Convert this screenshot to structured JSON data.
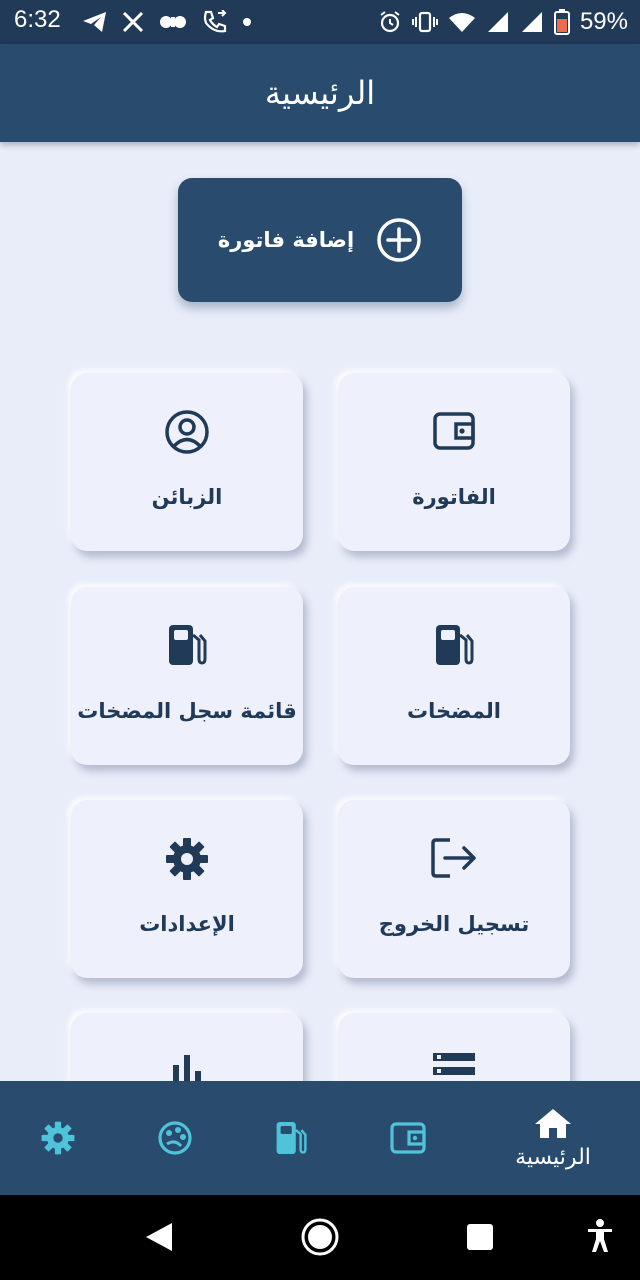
{
  "status_bar": {
    "time": "6:32",
    "battery_percent": "59%",
    "left_icons": [
      "telegram-icon",
      "x-icon",
      "voicemail-icon",
      "wifi-calling-icon",
      "dot-icon"
    ],
    "right_icons": [
      "alarm-icon",
      "vibrate-icon",
      "wifi-icon",
      "signal-icon",
      "signal-icon",
      "battery-icon"
    ]
  },
  "app_bar": {
    "title": "الرئيسية"
  },
  "add_invoice": {
    "label": "إضافة فاتورة",
    "icon": "plus-circle-icon"
  },
  "cards": [
    {
      "label": "الفاتورة",
      "icon": "wallet-icon"
    },
    {
      "label": "الزبائن",
      "icon": "user-circle-icon"
    },
    {
      "label": "المضخات",
      "icon": "fuel-pump-icon"
    },
    {
      "label": "قائمة سجل المضخات",
      "icon": "fuel-pump-icon"
    },
    {
      "label": "تسجيل الخروج",
      "icon": "logout-icon"
    },
    {
      "label": "الإعدادات",
      "icon": "gear-icon"
    },
    {
      "label": "",
      "icon": "list-icon"
    },
    {
      "label": "",
      "icon": "bar-chart-icon"
    }
  ],
  "bottom_nav": {
    "items": [
      {
        "label": "الرئيسية",
        "icon": "home-icon",
        "active": true
      },
      {
        "label": "",
        "icon": "wallet-icon"
      },
      {
        "label": "",
        "icon": "fuel-pump-icon"
      },
      {
        "label": "",
        "icon": "palette-icon"
      },
      {
        "label": "",
        "icon": "gear-icon"
      }
    ]
  },
  "colors": {
    "primary": "#284b6e",
    "background": "#e9edf9",
    "accent": "#4fc3d9",
    "text": "#203a57"
  }
}
